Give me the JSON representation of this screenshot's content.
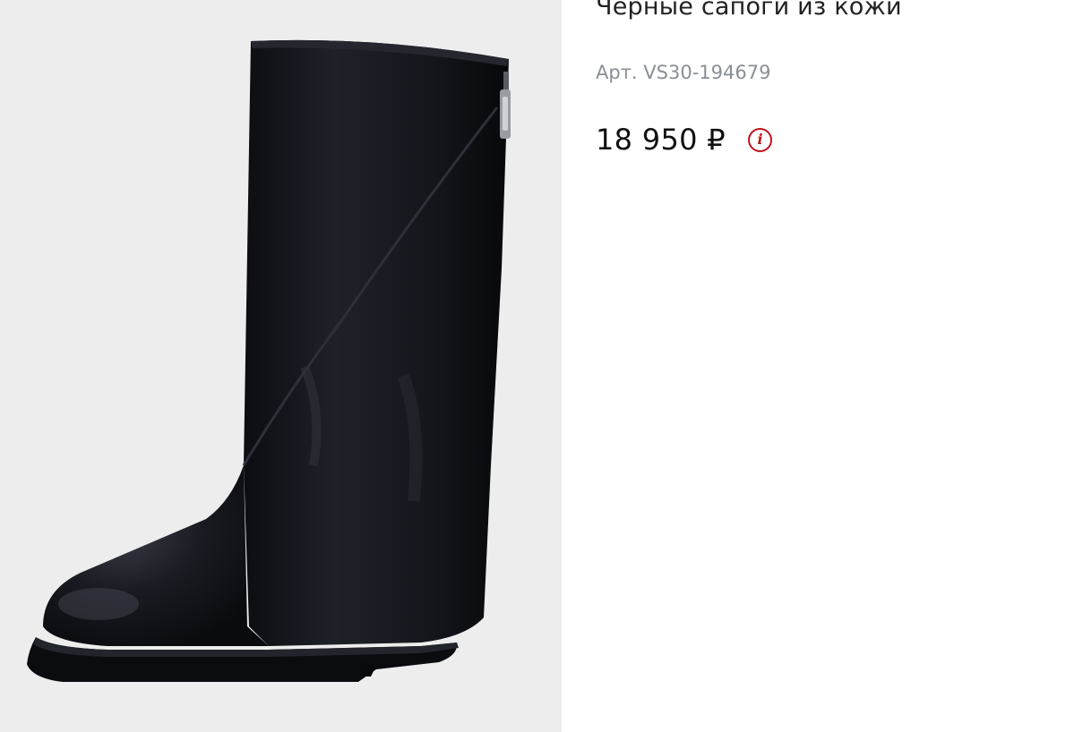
{
  "product": {
    "title": "Черные сапоги из кожи",
    "sku": "Арт. VS30-194679",
    "price": "18 950 ₽",
    "info_icon_glyph": "i",
    "image_alt": "Черные сапоги из кожи"
  },
  "colors": {
    "gallery_bg": "#ededee",
    "sku_text": "#8a8f96",
    "accent": "#c0141c"
  },
  "icons": {
    "info": "info-icon"
  }
}
